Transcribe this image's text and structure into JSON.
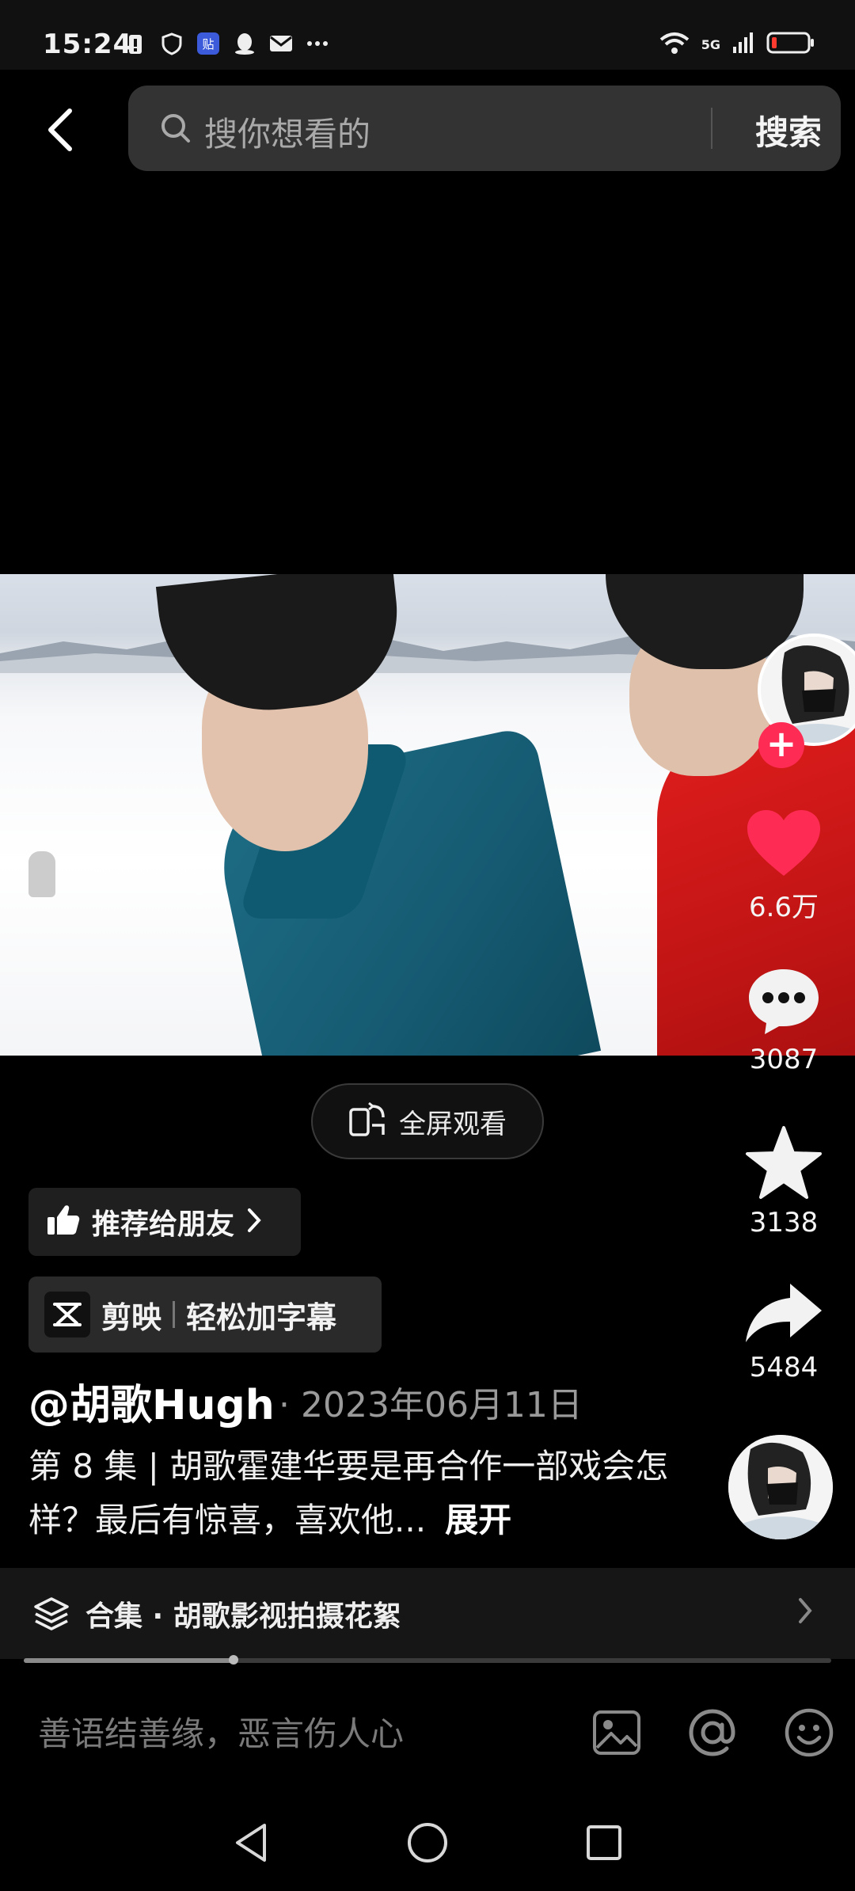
{
  "status_bar": {
    "time": "15:24",
    "network": "5G",
    "icons_left": [
      "battery-alert-icon",
      "shield-icon",
      "tieba-icon",
      "qq-icon",
      "mail-icon",
      "more-icon"
    ],
    "icons_right": [
      "wifi-icon",
      "signal-icon",
      "battery-icon"
    ]
  },
  "search": {
    "placeholder": "搜你想看的",
    "button_label": "搜索"
  },
  "video": {
    "fullscreen_label": "全屏观看",
    "progress": 0.26
  },
  "actions": {
    "likes": "6.6万",
    "comments": "3087",
    "favorites": "3138",
    "shares": "5484"
  },
  "post": {
    "recommend_label": "推荐给朋友",
    "capcut_label": "剪映",
    "capcut_sub": "轻松加字幕",
    "author": "@胡歌Hugh",
    "date": "· 2023年06月11日",
    "description": "第 8 集 | 胡歌霍建华要是再合作一部戏会怎样？最后有惊喜，喜欢他...",
    "expand_label": "展开"
  },
  "collection": {
    "label": "合集 · 胡歌影视拍摄花絮"
  },
  "comment_input": {
    "placeholder": "善语结善缘，恶言伤人心"
  },
  "colors": {
    "like": "#fe2c55",
    "background": "#000000",
    "search_bg": "#333333"
  }
}
